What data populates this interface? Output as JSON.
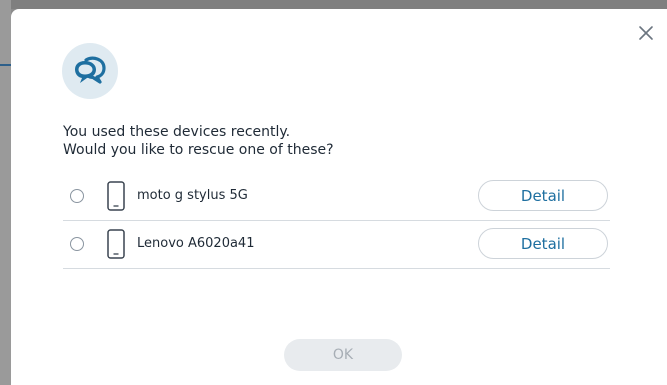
{
  "dialog": {
    "message_line1": "You used these devices recently.",
    "message_line2": "Would you like to rescue one of these?",
    "close_icon": "close-icon",
    "header_icon": "chat-bubbles-icon",
    "ok_label": "OK",
    "ok_enabled": false
  },
  "devices": [
    {
      "name": "moto g stylus 5G",
      "detail_label": "Detail",
      "selected": false,
      "icon": "phone-icon"
    },
    {
      "name": "Lenovo A6020a41",
      "detail_label": "Detail",
      "selected": false,
      "icon": "phone-icon"
    }
  ],
  "colors": {
    "accent": "#1e6fa0",
    "icon_bg": "#dfeaf1",
    "text": "#1f2a36",
    "disabled_button_bg": "#e8ebee",
    "disabled_button_text": "#a7aeb5"
  }
}
